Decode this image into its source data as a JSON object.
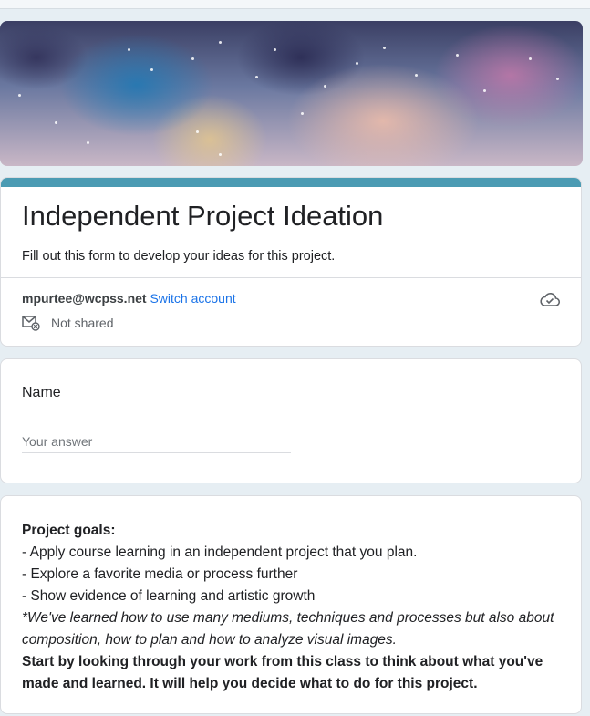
{
  "form": {
    "title": "Independent Project Ideation",
    "description": "Fill out this form to develop your ideas for this project.",
    "accent_color": "#4b9bb3"
  },
  "account": {
    "email": "mpurtee@wcpss.net",
    "switch_label": "Switch account",
    "shared_status": "Not shared",
    "cloud_icon": "cloud-check-icon",
    "shared_icon": "mail-not-shared-icon"
  },
  "question_name": {
    "label": "Name",
    "placeholder": "Your answer"
  },
  "goals": {
    "heading": "Project goals:",
    "bullets": [
      "- Apply course learning in an independent project that you plan.",
      "- Explore a favorite media or process further",
      "- Show evidence of learning and artistic growth"
    ],
    "italic_note": "*We've learned how to use many mediums, techniques and processes but also about composition, how to plan and how to analyze visual images.",
    "bold_closing": "Start by looking through your work from this class to think about what you've made and learned. It will help you decide what to do for this project."
  }
}
